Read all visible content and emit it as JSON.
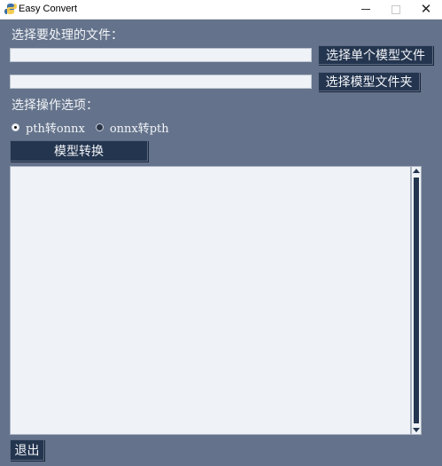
{
  "window": {
    "title": "Easy Convert",
    "close_glyph": "✕"
  },
  "form": {
    "files_label": "选择要处理的文件：",
    "file_input_value": "",
    "folder_input_value": "",
    "select_file_button": "选择单个模型文件",
    "select_folder_button": "选择模型文件夹",
    "options_label": "选择操作选项：",
    "options": [
      {
        "label": "pth转onnx",
        "selected": true
      },
      {
        "label": "onnx转pth",
        "selected": false
      }
    ],
    "convert_button": "模型转换",
    "output_text": "",
    "exit_button": "退出"
  },
  "icons": {
    "app": "python-feather-icon",
    "minimize": "minimize-icon",
    "maximize": "maximize-icon",
    "close": "close-icon"
  },
  "colors": {
    "background": "#64738b",
    "button": "#24354f",
    "field": "#eff2f7"
  }
}
